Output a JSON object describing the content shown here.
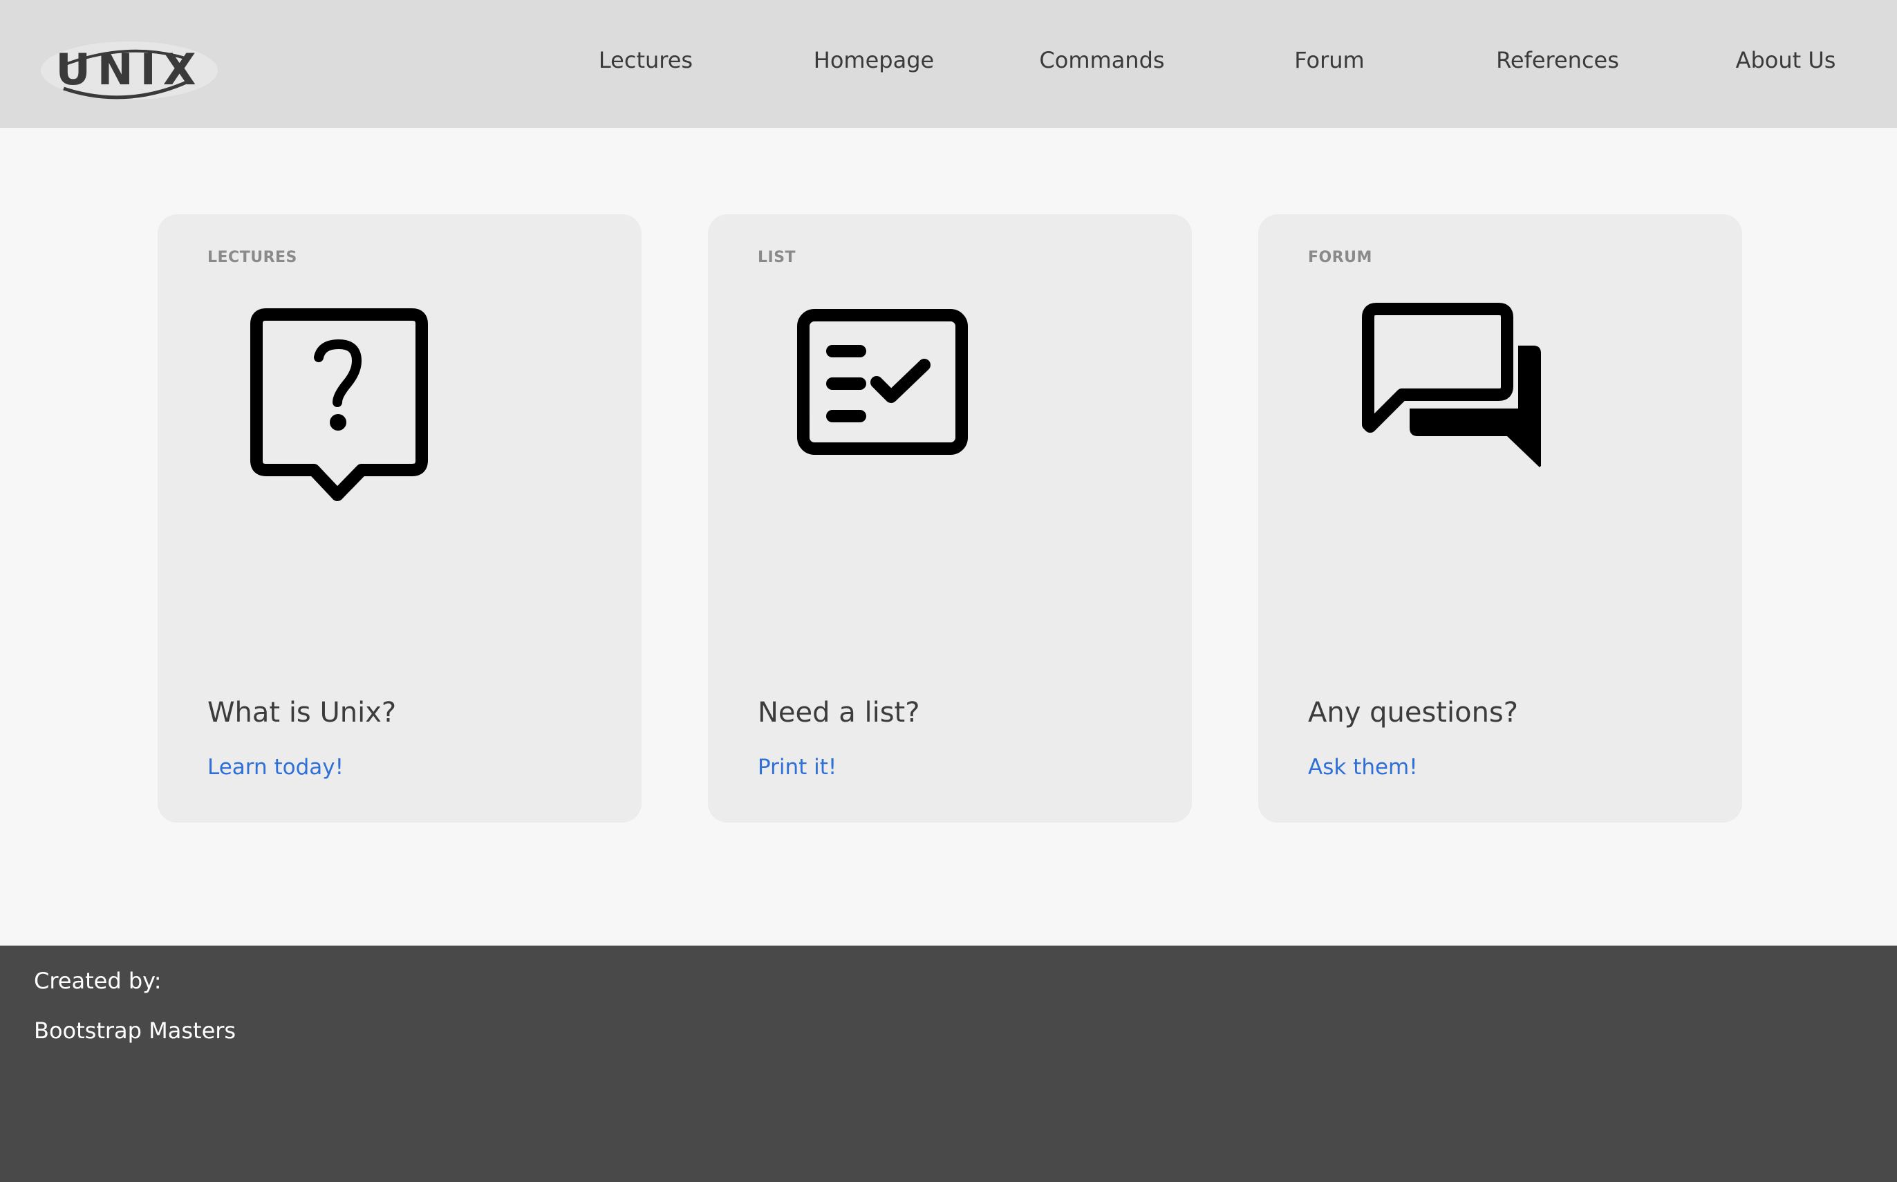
{
  "brand": {
    "logo_text": "UNIX"
  },
  "nav": {
    "items": [
      {
        "label": "Lectures"
      },
      {
        "label": "Homepage"
      },
      {
        "label": "Commands"
      },
      {
        "label": "Forum"
      },
      {
        "label": "References"
      },
      {
        "label": "About Us"
      }
    ]
  },
  "cards": [
    {
      "tag": "LECTURES",
      "icon": "question-bubble-icon",
      "title": "What is Unix?",
      "link": "Learn today!"
    },
    {
      "tag": "LIST",
      "icon": "checklist-icon",
      "title": "Need a list?",
      "link": "Print it!"
    },
    {
      "tag": "FORUM",
      "icon": "chat-bubbles-icon",
      "title": "Any questions?",
      "link": "Ask them!"
    }
  ],
  "footer": {
    "created_by_label": "Created by:",
    "author": "Bootstrap Masters"
  },
  "colors": {
    "navbar_bg": "#dcdcdc",
    "page_bg": "#f7f7f7",
    "card_bg": "#ececec",
    "link": "#2f6fd8",
    "footer_bg": "#494949"
  }
}
